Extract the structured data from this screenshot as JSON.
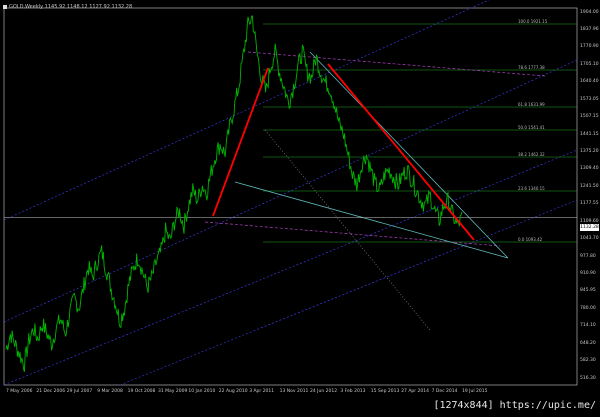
{
  "chart_info": "GOLD,Weekly  1145.92  1148.12  1127.92  1132.28",
  "current_price": "1132.28",
  "watermark": "[1274x844] https://upic.me/",
  "price_ticks": [
    "1904.00",
    "1837.96",
    "1770.90",
    "1705.10",
    "1640.40",
    "1573.05",
    "1507.15",
    "1441.15",
    "1375.20",
    "1309.40",
    "1241.50",
    "1177.55",
    "1109.60",
    "1043.70",
    "977.80",
    "910.90",
    "845.95",
    "780.00",
    "714.10",
    "648.20",
    "582.30",
    "516.30"
  ],
  "date_ticks": [
    "7 May 2006",
    "21 Dec 2006",
    "29 Jul 2007",
    "9 Mar 2008",
    "19 Oct 2008",
    "31 May 2009",
    "10 Jan 2010",
    "22 Aug 2010",
    "3 Apr 2011",
    "13 Nov 2011",
    "24 Jun 2012",
    "3 Feb 2013",
    "15 Sep 2013",
    "27 Apr 2014",
    "7 Dec 2014",
    "19 Jul 2015"
  ],
  "fib_labels": [
    "100.0 1921.15",
    "78.6 1777.38",
    "61.8 1631.99",
    "50.0 1541.41",
    "38.2 1462.32",
    "23.6 1340.15",
    "0.0 1093.42"
  ],
  "colors": {
    "price": "#00b400",
    "red": "#ff0000",
    "fib": "#22aa22",
    "channel": "#4040ff",
    "fan_grey": "#9a9a9a",
    "teal": "#5fbaba",
    "magenta": "#b040c0"
  },
  "chart_data": {
    "type": "line",
    "series": [
      {
        "values": [
          620,
          680,
          640,
          600,
          560,
          650,
          700,
          660,
          720,
          680,
          640,
          700,
          740,
          680,
          760,
          820,
          780,
          860,
          940,
          900,
          960,
          1000,
          930,
          860,
          800,
          730,
          780,
          880,
          940,
          980,
          920,
          860,
          900,
          960,
          1000,
          1080,
          1040,
          1120,
          1160,
          1100,
          1180,
          1240,
          1200,
          1260,
          1230,
          1310,
          1380,
          1420,
          1380,
          1480,
          1560,
          1640,
          1760,
          1880,
          1920,
          1780,
          1680,
          1620,
          1720,
          1780,
          1700,
          1640,
          1580,
          1640,
          1720,
          1780,
          1700,
          1680,
          1760,
          1700,
          1660,
          1640,
          1580,
          1500,
          1460,
          1380,
          1300,
          1260,
          1340,
          1380,
          1320,
          1260,
          1240,
          1300,
          1320,
          1290,
          1260,
          1300,
          1320,
          1280,
          1240,
          1200,
          1180,
          1220,
          1160,
          1120,
          1180,
          1200,
          1140,
          1100,
          1132
        ]
      }
    ],
    "ylim": [
      480,
      1950
    ],
    "grid": false
  }
}
